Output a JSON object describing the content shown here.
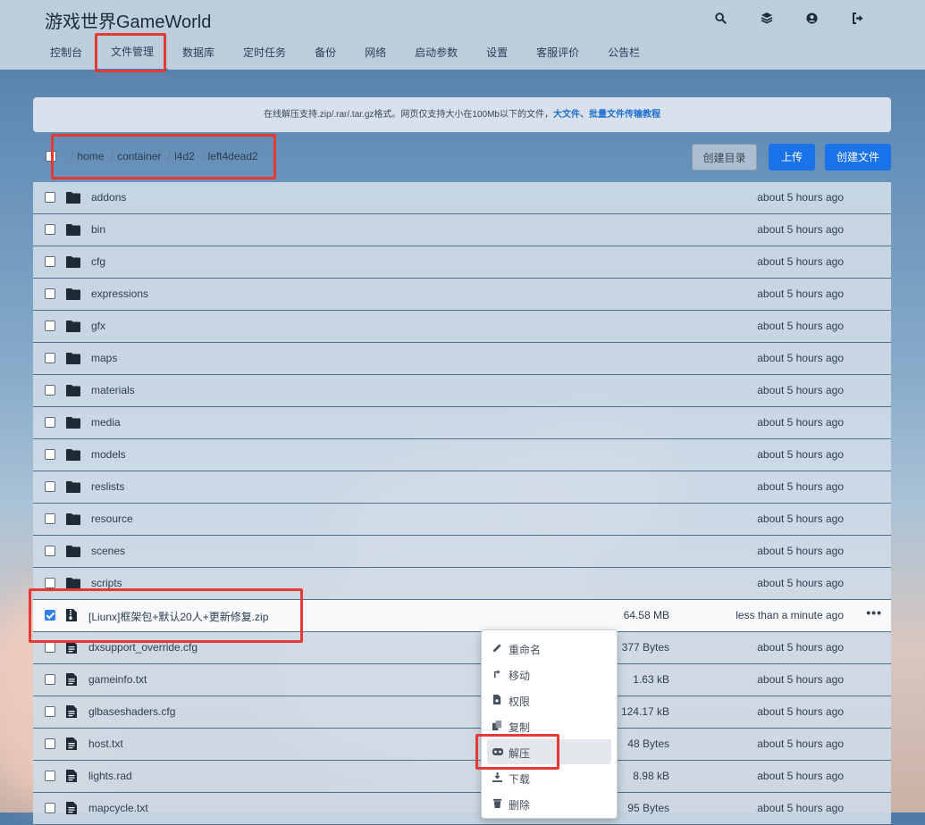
{
  "header": {
    "brand": "游戏世界GameWorld",
    "icons": [
      "search-icon",
      "layers-icon",
      "user-icon",
      "logout-icon"
    ]
  },
  "nav": {
    "items": [
      {
        "label": "控制台"
      },
      {
        "label": "文件管理",
        "active": true
      },
      {
        "label": "数据库"
      },
      {
        "label": "定时任务"
      },
      {
        "label": "备份"
      },
      {
        "label": "网络"
      },
      {
        "label": "启动参数"
      },
      {
        "label": "设置"
      },
      {
        "label": "客服评价"
      },
      {
        "label": "公告栏"
      }
    ]
  },
  "notice": {
    "text": "在线解压支持.zip/.rar/.tar.gz格式。网页仅支持大小在100Mb以下的文件，",
    "link": "大文件、批量文件传输教程"
  },
  "breadcrumb": {
    "parts": [
      "home",
      "container",
      "l4d2",
      "left4dead2"
    ]
  },
  "toolbar": {
    "mkdir_label": "创建目录",
    "upload_label": "上传",
    "create_file_label": "创建文件"
  },
  "files": [
    {
      "name": "addons",
      "type": "folder",
      "size": "",
      "time": "about 5 hours ago"
    },
    {
      "name": "bin",
      "type": "folder",
      "size": "",
      "time": "about 5 hours ago"
    },
    {
      "name": "cfg",
      "type": "folder",
      "size": "",
      "time": "about 5 hours ago"
    },
    {
      "name": "expressions",
      "type": "folder",
      "size": "",
      "time": "about 5 hours ago"
    },
    {
      "name": "gfx",
      "type": "folder",
      "size": "",
      "time": "about 5 hours ago"
    },
    {
      "name": "maps",
      "type": "folder",
      "size": "",
      "time": "about 5 hours ago"
    },
    {
      "name": "materials",
      "type": "folder",
      "size": "",
      "time": "about 5 hours ago"
    },
    {
      "name": "media",
      "type": "folder",
      "size": "",
      "time": "about 5 hours ago"
    },
    {
      "name": "models",
      "type": "folder",
      "size": "",
      "time": "about 5 hours ago"
    },
    {
      "name": "reslists",
      "type": "folder",
      "size": "",
      "time": "about 5 hours ago"
    },
    {
      "name": "resource",
      "type": "folder",
      "size": "",
      "time": "about 5 hours ago"
    },
    {
      "name": "scenes",
      "type": "folder",
      "size": "",
      "time": "about 5 hours ago"
    },
    {
      "name": "scripts",
      "type": "folder",
      "size": "",
      "time": "about 5 hours ago"
    },
    {
      "name": "[Liunx]框架包+默认20人+更新修复.zip",
      "type": "archive",
      "size": "64.58 MB",
      "time": "less than a minute ago",
      "checked": true
    },
    {
      "name": "dxsupport_override.cfg",
      "type": "file",
      "size": "377 Bytes",
      "time": "about 5 hours ago"
    },
    {
      "name": "gameinfo.txt",
      "type": "file",
      "size": "1.63 kB",
      "time": "about 5 hours ago"
    },
    {
      "name": "glbaseshaders.cfg",
      "type": "file",
      "size": "124.17 kB",
      "time": "about 5 hours ago"
    },
    {
      "name": "host.txt",
      "type": "file",
      "size": "48 Bytes",
      "time": "about 5 hours ago"
    },
    {
      "name": "lights.rad",
      "type": "file",
      "size": "8.98 kB",
      "time": "about 5 hours ago"
    },
    {
      "name": "mapcycle.txt",
      "type": "file",
      "size": "95 Bytes",
      "time": "about 5 hours ago"
    }
  ],
  "context_menu": {
    "items": [
      {
        "label": "重命名",
        "icon": "pencil-icon"
      },
      {
        "label": "移动",
        "icon": "move-arrow-icon"
      },
      {
        "label": "权限",
        "icon": "permission-icon"
      },
      {
        "label": "复制",
        "icon": "copy-icon"
      },
      {
        "label": "解压",
        "icon": "extract-icon",
        "highlighted": true
      },
      {
        "label": "下载",
        "icon": "download-icon"
      },
      {
        "label": "删除",
        "icon": "trash-icon"
      }
    ]
  },
  "colors": {
    "primary": "#1a73e8",
    "highlight_box": "#e53935",
    "header_bg": "#c4d4e2"
  }
}
